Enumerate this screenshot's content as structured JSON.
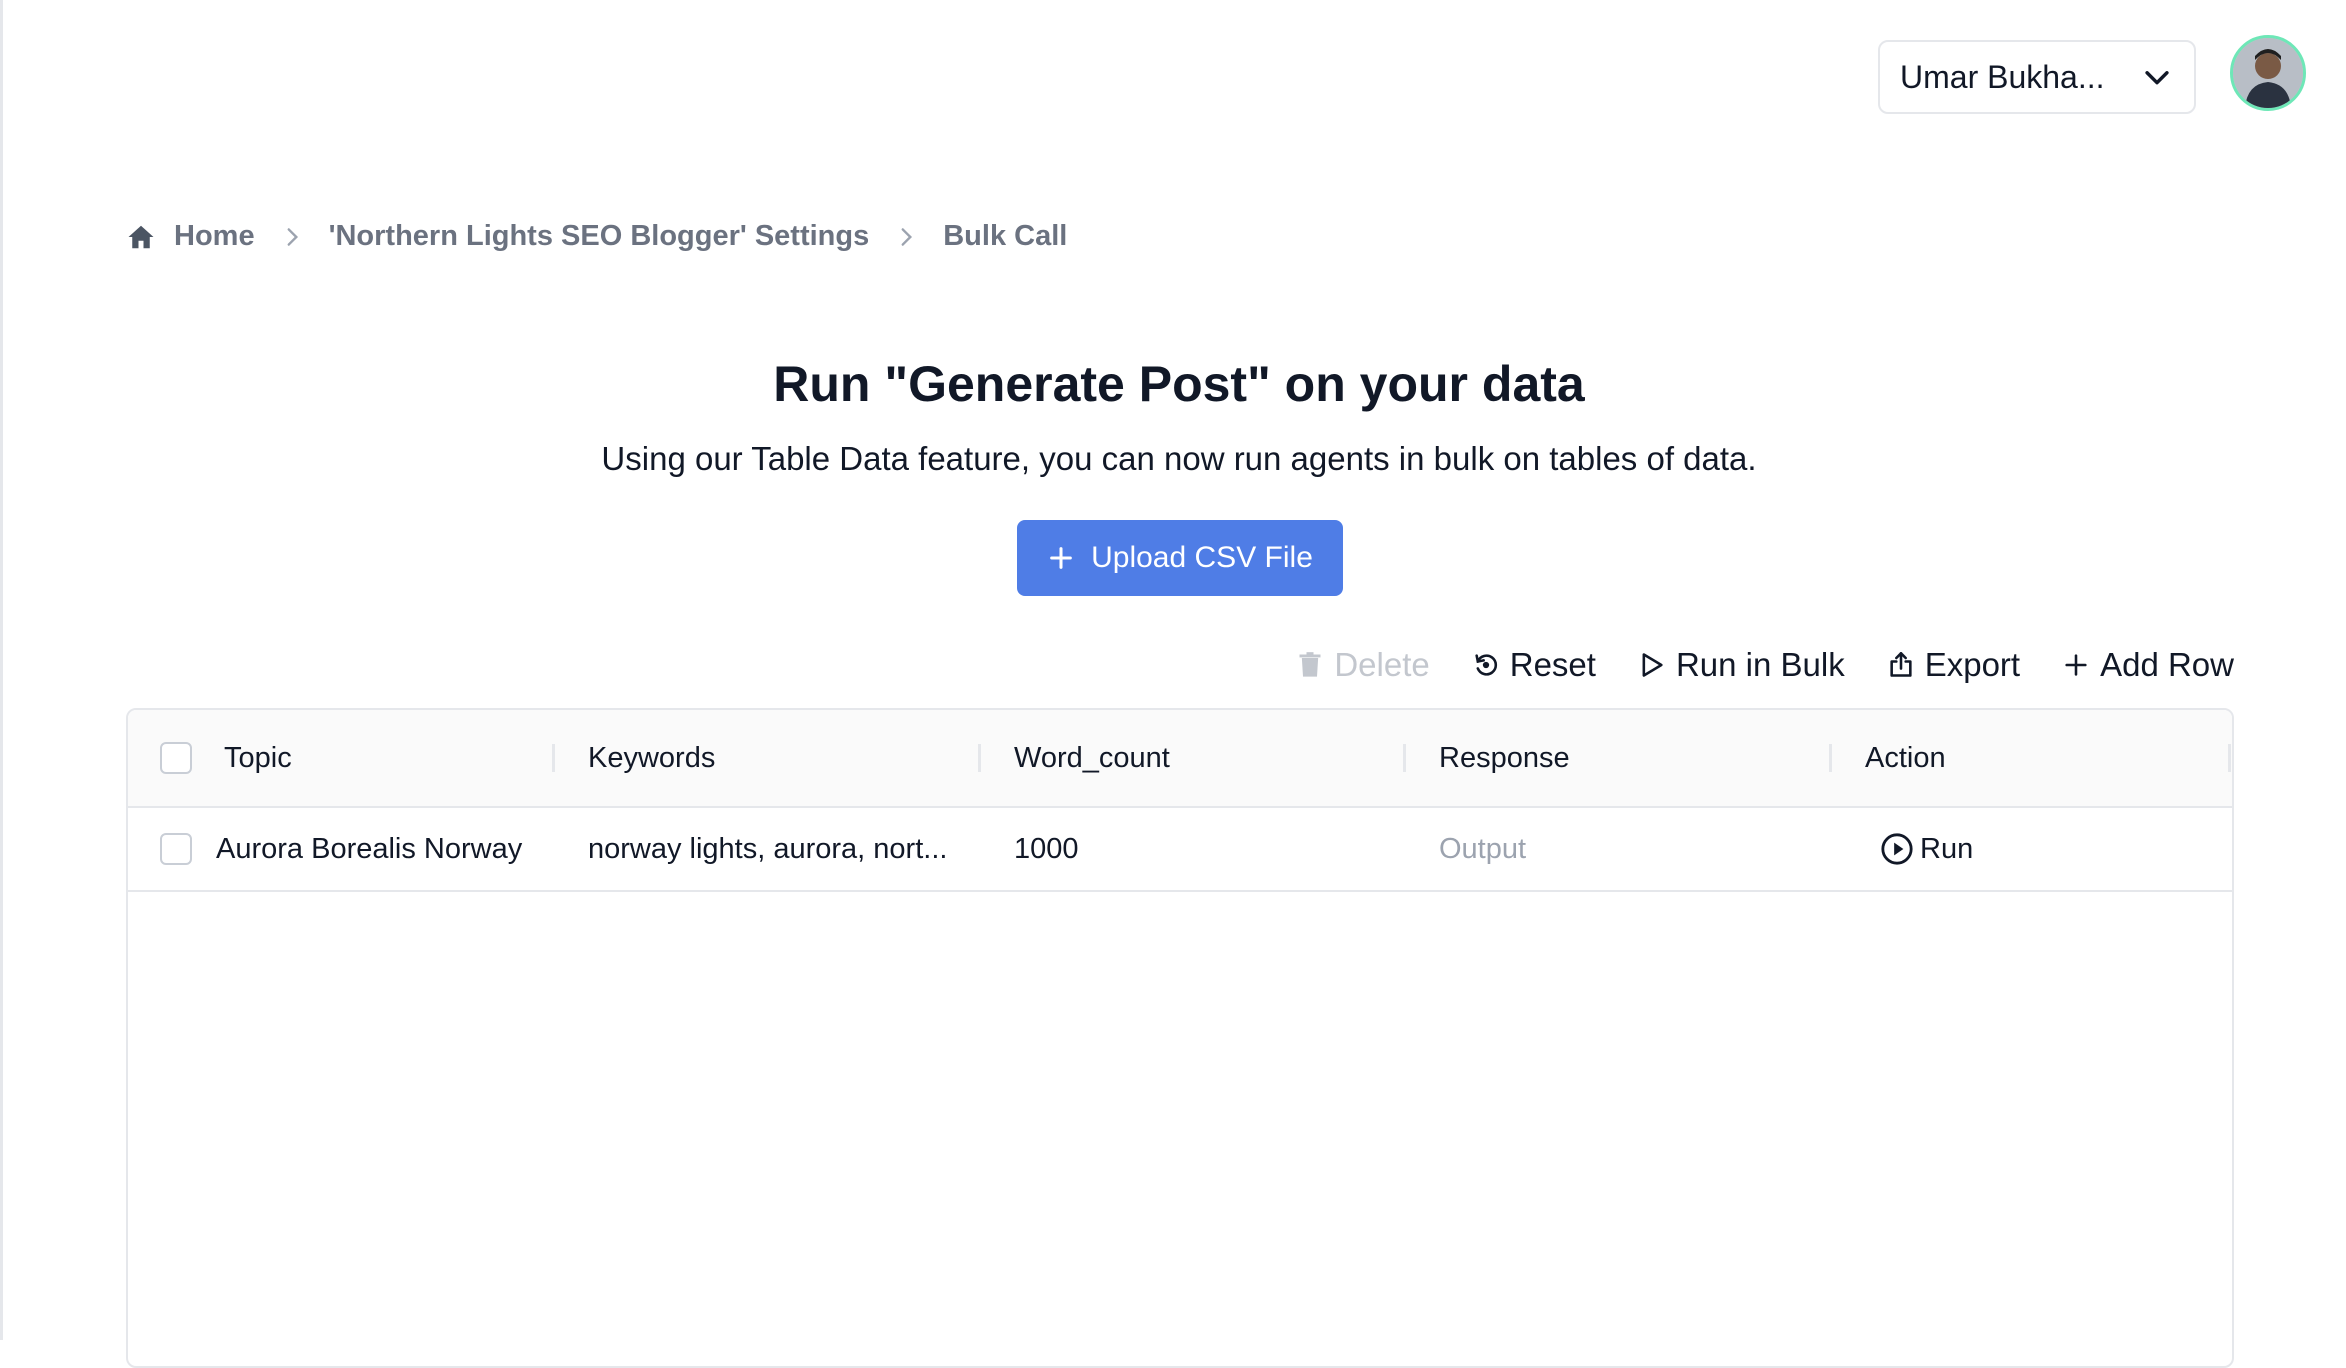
{
  "header": {
    "user_name": "Umar Bukha...",
    "avatar_alt": "user avatar"
  },
  "breadcrumb": {
    "items": [
      {
        "label": "Home",
        "icon": "home-icon"
      },
      {
        "label": "'Northern Lights SEO Blogger' Settings"
      },
      {
        "label": "Bulk Call"
      }
    ]
  },
  "main": {
    "title": "Run \"Generate Post\" on your data",
    "subtitle": "Using our Table Data feature, you can now run agents in bulk on tables of data.",
    "upload_label": "Upload CSV File"
  },
  "toolbar": {
    "delete_label": "Delete",
    "reset_label": "Reset",
    "run_bulk_label": "Run in Bulk",
    "export_label": "Export",
    "add_row_label": "Add Row"
  },
  "table": {
    "columns": [
      "Topic",
      "Keywords",
      "Word_count",
      "Response",
      "Action"
    ],
    "rows": [
      {
        "topic": "Aurora Borealis Norway",
        "keywords": "norway lights, aurora, nort...",
        "word_count": "1000",
        "response": "Output",
        "action": "Run"
      }
    ]
  },
  "colors": {
    "primary": "#4f7de6",
    "avatar_ring": "#6ee7b7",
    "border": "#e5e7eb",
    "muted": "#9ca3af"
  }
}
